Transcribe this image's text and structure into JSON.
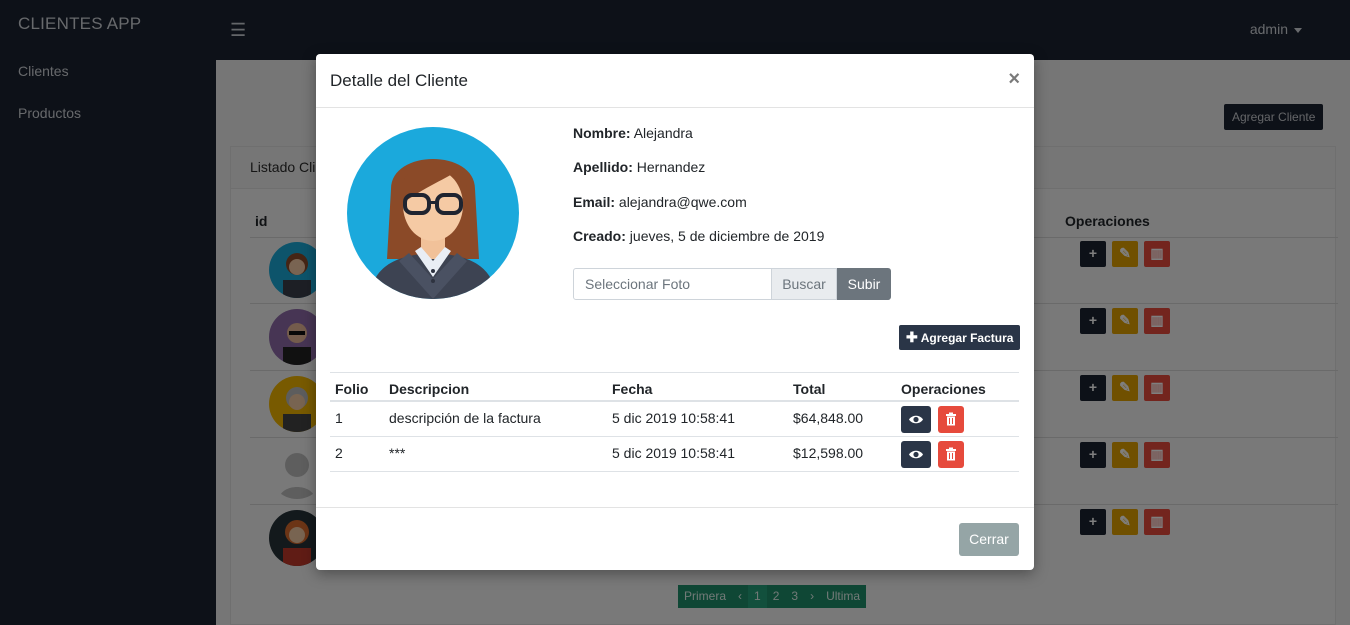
{
  "app": {
    "brand": "CLIENTES APP",
    "nav": [
      {
        "label": "Clientes"
      },
      {
        "label": "Productos"
      }
    ],
    "user_menu": "admin"
  },
  "background": {
    "add_client_label": "Agregar Cliente",
    "card_title": "Listado Clie",
    "table_headers": {
      "id": "id",
      "operations": "Operaciones"
    },
    "pagination": [
      "Primera",
      "‹",
      "1",
      "2",
      "3",
      "›",
      "Ultima"
    ]
  },
  "modal": {
    "title": "Detalle del Cliente",
    "close_symbol": "×",
    "fields": [
      {
        "label": "Nombre:",
        "value": "Alejandra"
      },
      {
        "label": "Apellido:",
        "value": "Hernandez"
      },
      {
        "label": "Email:",
        "value": "alejandra@qwe.com"
      },
      {
        "label": "Creado:",
        "value": "jueves, 5 de diciembre de 2019"
      }
    ],
    "upload": {
      "placeholder": "Seleccionar Foto",
      "browse_label": "Buscar",
      "submit_label": "Subir"
    },
    "add_invoice_label": "Agregar Factura",
    "invoice_headers": {
      "folio": "Folio",
      "description": "Descripcion",
      "date": "Fecha",
      "total": "Total",
      "operations": "Operaciones"
    },
    "invoices": [
      {
        "folio": "1",
        "description": "descripción de la factura",
        "date": "5 dic 2019 10:58:41",
        "total": "$64,848.00"
      },
      {
        "folio": "2",
        "description": "***",
        "date": "5 dic 2019 10:58:41",
        "total": "$12,598.00"
      }
    ],
    "close_label": "Cerrar"
  }
}
